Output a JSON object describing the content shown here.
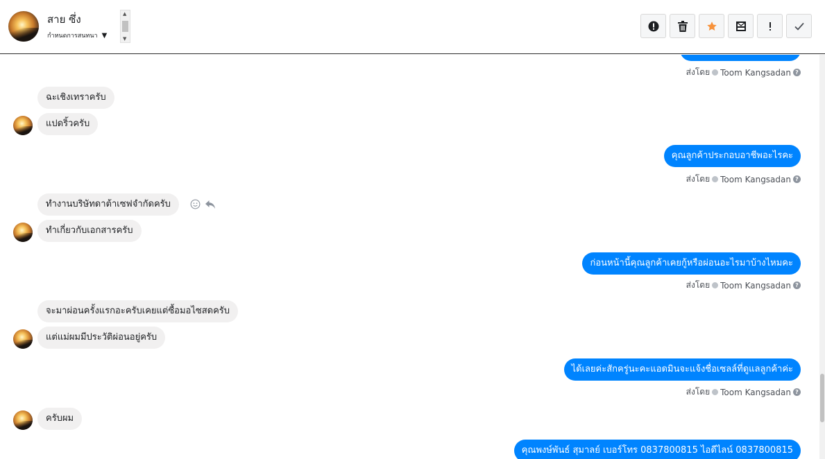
{
  "header": {
    "contact_name": "สาย ซึ่ง",
    "conversation_select": "กำหนดการสนทนา",
    "toolbar": [
      {
        "name": "report-spam-button",
        "icon": "alert-circle-icon"
      },
      {
        "name": "delete-button",
        "icon": "trash-icon"
      },
      {
        "name": "star-button",
        "icon": "star-icon",
        "color": "#f7923b"
      },
      {
        "name": "archive-button",
        "icon": "archive-icon"
      },
      {
        "name": "mark-important-button",
        "icon": "exclamation-icon"
      },
      {
        "name": "mark-done-button",
        "icon": "check-icon"
      }
    ]
  },
  "sent_by_label": "ส่งโดย",
  "agent_name": "Toom Kangsadan",
  "messages": {
    "in": [
      "ฉะเชิงเทราครับ",
      "แปดริ้วครับ",
      "ทำงานบริษัทดาต้าเซฟจำกัดครับ",
      "ทำเกี่ยวกับเอกสารครับ",
      "จะมาผ่อนครั้งแรกอะครับเคยแต่ซื้อมอไซสดครับ",
      "แต่แม่ผมมีประวัติผ่อนอยู่ครับ",
      "ครับผม"
    ],
    "out": [
      "คุณลูกค้าประกอบอาชีพอะไรคะ",
      "ก่อนหน้านี้คุณลูกค้าเคยกู้หรือผ่อนอะไรมาบ้างไหมคะ",
      "ได้เลยค่ะสักครู่นะคะแอดมินจะแจ้งชื่อเซลล์ที่ดูแลลูกค้าค่ะ",
      "คุณพงษ์พันธ์ สุมาลย์     เบอร์โทร 0837800815  ไอดีไลน์ 0837800815"
    ]
  },
  "colors": {
    "outgoing_bubble": "#0084ff",
    "incoming_bubble": "#f1f0f0"
  }
}
